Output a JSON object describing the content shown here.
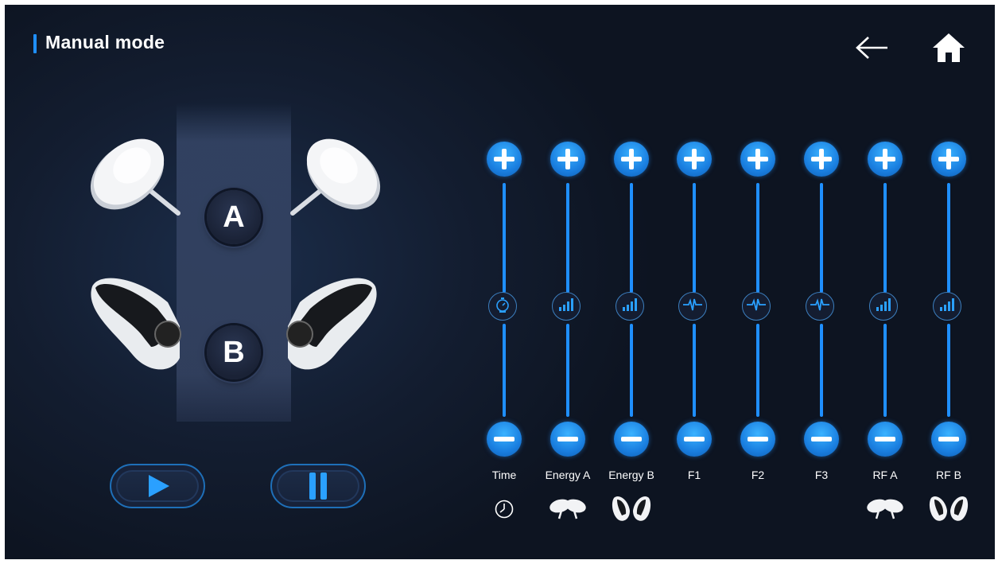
{
  "header": {
    "title": "Manual mode",
    "back_icon": "arrow-left-icon",
    "home_icon": "home-icon"
  },
  "zones": [
    {
      "label": "A"
    },
    {
      "label": "B"
    }
  ],
  "controls": {
    "play_icon": "play-icon",
    "pause_icon": "pause-icon"
  },
  "sliders": [
    {
      "label": "Time",
      "knob_icon": "stopwatch-icon",
      "bottom_icon": "clock-icon"
    },
    {
      "label": "Energy A",
      "knob_icon": "signal-bars-icon",
      "bottom_icon": "applicator-a-icon"
    },
    {
      "label": "Energy B",
      "knob_icon": "signal-bars-icon",
      "bottom_icon": "applicator-b-icon"
    },
    {
      "label": "F1",
      "knob_icon": "pulse-wave-icon",
      "bottom_icon": ""
    },
    {
      "label": "F2",
      "knob_icon": "pulse-wave-icon",
      "bottom_icon": ""
    },
    {
      "label": "F3",
      "knob_icon": "pulse-wave-icon",
      "bottom_icon": ""
    },
    {
      "label": "RF A",
      "knob_icon": "signal-bars-icon",
      "bottom_icon": "applicator-a-icon"
    },
    {
      "label": "RF B",
      "knob_icon": "signal-bars-icon",
      "bottom_icon": "applicator-b-icon"
    }
  ],
  "colors": {
    "accent": "#1f8fff",
    "background": "#131d30",
    "text": "#ffffff"
  }
}
